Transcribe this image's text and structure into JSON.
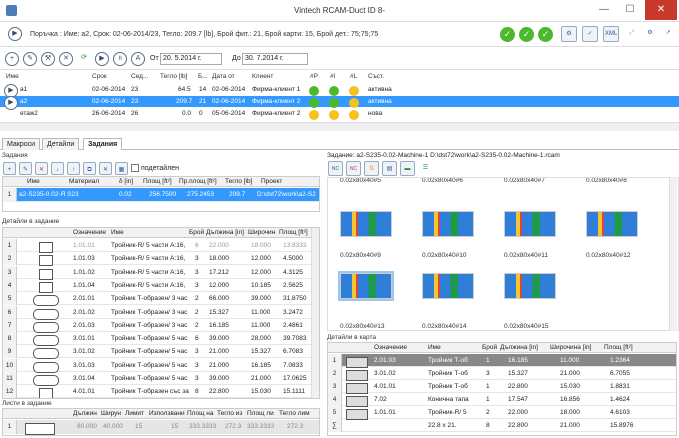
{
  "window": {
    "title": "Vintech RCAM-Duct ID 8-"
  },
  "info": {
    "order_text": "Поръчка : Име: а2, Срок: 02-06-2014/23, Тегло: 209.7 [lb], Брой фит.: 21, Брой карти: 15, Брой дет.: 75;75;75"
  },
  "toolbar": {
    "from_label": "От",
    "from_date": "20. 5.2014 г.",
    "to_label": "До",
    "to_date": "30. 7.2014 г."
  },
  "orders": {
    "headers": [
      "Име",
      "Срок",
      "Сед...",
      "Тегло [lb]",
      "Б...",
      "Дата от",
      "Клиент",
      "#P",
      "#I",
      "#L",
      "Съст."
    ],
    "rows": [
      {
        "name": "а1",
        "due": "02-06-2014",
        "week": "23",
        "weight": "64.5",
        "count": "14",
        "date": "02-06-2014",
        "client": "Фирма-клиент 1",
        "status": "активна"
      },
      {
        "name": "а2",
        "due": "02-06-2014",
        "week": "23",
        "weight": "209.7",
        "count": "21",
        "date": "02-06-2014",
        "client": "Фирма-клиент 2",
        "status": "активна"
      },
      {
        "name": "етаж2",
        "due": "26-06-2014",
        "week": "26",
        "weight": "0.0",
        "count": "0",
        "date": "05-06-2014",
        "client": "Фирма-клиент 2",
        "status": "нова"
      }
    ]
  },
  "tabs": [
    "Макроси",
    "Детайли",
    "Задания"
  ],
  "tasks": {
    "section": "Задания",
    "detailed_label": "подетайлен",
    "headers": [
      "Име",
      "Материал",
      "δ [in]",
      "Площ [ft²]",
      "Пр.площ [ft²]",
      "Тегло [lb]",
      "Проект"
    ],
    "row": [
      "а2-S235-0.02-Я S235",
      "",
      "0.02",
      "256.7500",
      "275.2453",
      "209.7",
      "D:\\dst72\\work\\а2-S2"
    ]
  },
  "details": {
    "section": "Детайли в задание",
    "headers": [
      "Означение",
      "Име",
      "Брой",
      "Дължина [in]",
      "Широчин",
      "Площ [ft²]"
    ],
    "rows": [
      [
        "1.01.01",
        "Тройник-R/ 5 части А:16,",
        "6",
        "22.000",
        "18.000",
        "13.8333"
      ],
      [
        "1.01.03",
        "Тройник-R/ 5 части А:16,",
        "3",
        "18.000",
        "12.000",
        "4.5000"
      ],
      [
        "1.01.02",
        "Тройник-R/ 5 части А:16,",
        "3",
        "17.212",
        "12.000",
        "4.3125"
      ],
      [
        "1.01.04",
        "Тройник-R/ 5 части А:16,",
        "3",
        "12.000",
        "10.185",
        "2.5625"
      ],
      [
        "2.01.01",
        "Тройник Т-образен/ 3 час",
        "2",
        "66.000",
        "39.000",
        "31.8750"
      ],
      [
        "2.01.02",
        "Тройник Т-образен/ 3 час",
        "2",
        "15.327",
        "11.000",
        "3.2472"
      ],
      [
        "2.01.03",
        "Тройник Т-образен/ 3 час",
        "2",
        "16.185",
        "11.000",
        "2.4861"
      ],
      [
        "3.01.01",
        "Тройник Т-образен/ 5 час",
        "6",
        "39.000",
        "28.000",
        "39.7083"
      ],
      [
        "3.01.02",
        "Тройник Т-образен/ 5 час",
        "3",
        "21.000",
        "15.327",
        "6.7083"
      ],
      [
        "3.01.03",
        "Тройник Т-образен/ 5 час",
        "3",
        "21.000",
        "16.185",
        "7.0833"
      ],
      [
        "3.01.04",
        "Тройник Т-образен/ 5 час",
        "3",
        "39.000",
        "21.000",
        "17.0625"
      ],
      [
        "4.01.01",
        "Тройник Т-образен със за",
        "8",
        "22.800",
        "15.030",
        "15.1111"
      ]
    ]
  },
  "sheets": {
    "section": "Листи в задание",
    "headers": [
      "Дължин",
      "Ширун",
      "Лимит",
      "Използвани",
      "Площ на",
      "Тегло из",
      "Площ ли",
      "Тегло лим"
    ],
    "row": [
      "80.000",
      "40.000",
      "15",
      "15",
      "333.3333",
      "272.3",
      "333.3333",
      "272.3"
    ]
  },
  "right": {
    "title": "Задание: а2-S235-0.02-Machine-1 D:\\dst72\\work\\а2-S235-0.02-Machine-1.rcam",
    "thumbs_top": [
      "0.02x80x40#5",
      "0.02x80x40#6",
      "0.02x80x40#7",
      "0.02x80x40#8"
    ],
    "thumbs_mid": [
      "0.02x80x40#9",
      "0.02x80x40#10",
      "0.02x80x40#11",
      "0.02x80x40#12"
    ],
    "thumbs_bot": [
      "0.02x80x40#13",
      "0.02x80x40#14",
      "0.02x80x40#15"
    ],
    "cards_section": "Детайли в карта",
    "cards_headers": [
      "Означение",
      "Име",
      "Брой",
      "Дължина [in]",
      "Широчина [in]",
      "Площ [ft²]"
    ],
    "cards_rows": [
      [
        "2.01.03",
        "Тройник Т-об",
        "1",
        "16.185",
        "11.000",
        "1.2364"
      ],
      [
        "3.01.02",
        "Тройник Т-об",
        "3",
        "15.327",
        "21.000",
        "6.7055"
      ],
      [
        "4.01.01",
        "Тройник Т-об",
        "1",
        "22.800",
        "15.030",
        "1.8831"
      ],
      [
        "7.02",
        "Конична тапа",
        "1",
        "17.547",
        "16.856",
        "1.4624"
      ],
      [
        "1.01.01",
        "Тройник-R/ 5",
        "2",
        "22.000",
        "18.000",
        "4.6103"
      ]
    ],
    "cards_total": [
      "22.8 x 21.",
      "8",
      "22.800",
      "21.000",
      "15.8976"
    ]
  }
}
